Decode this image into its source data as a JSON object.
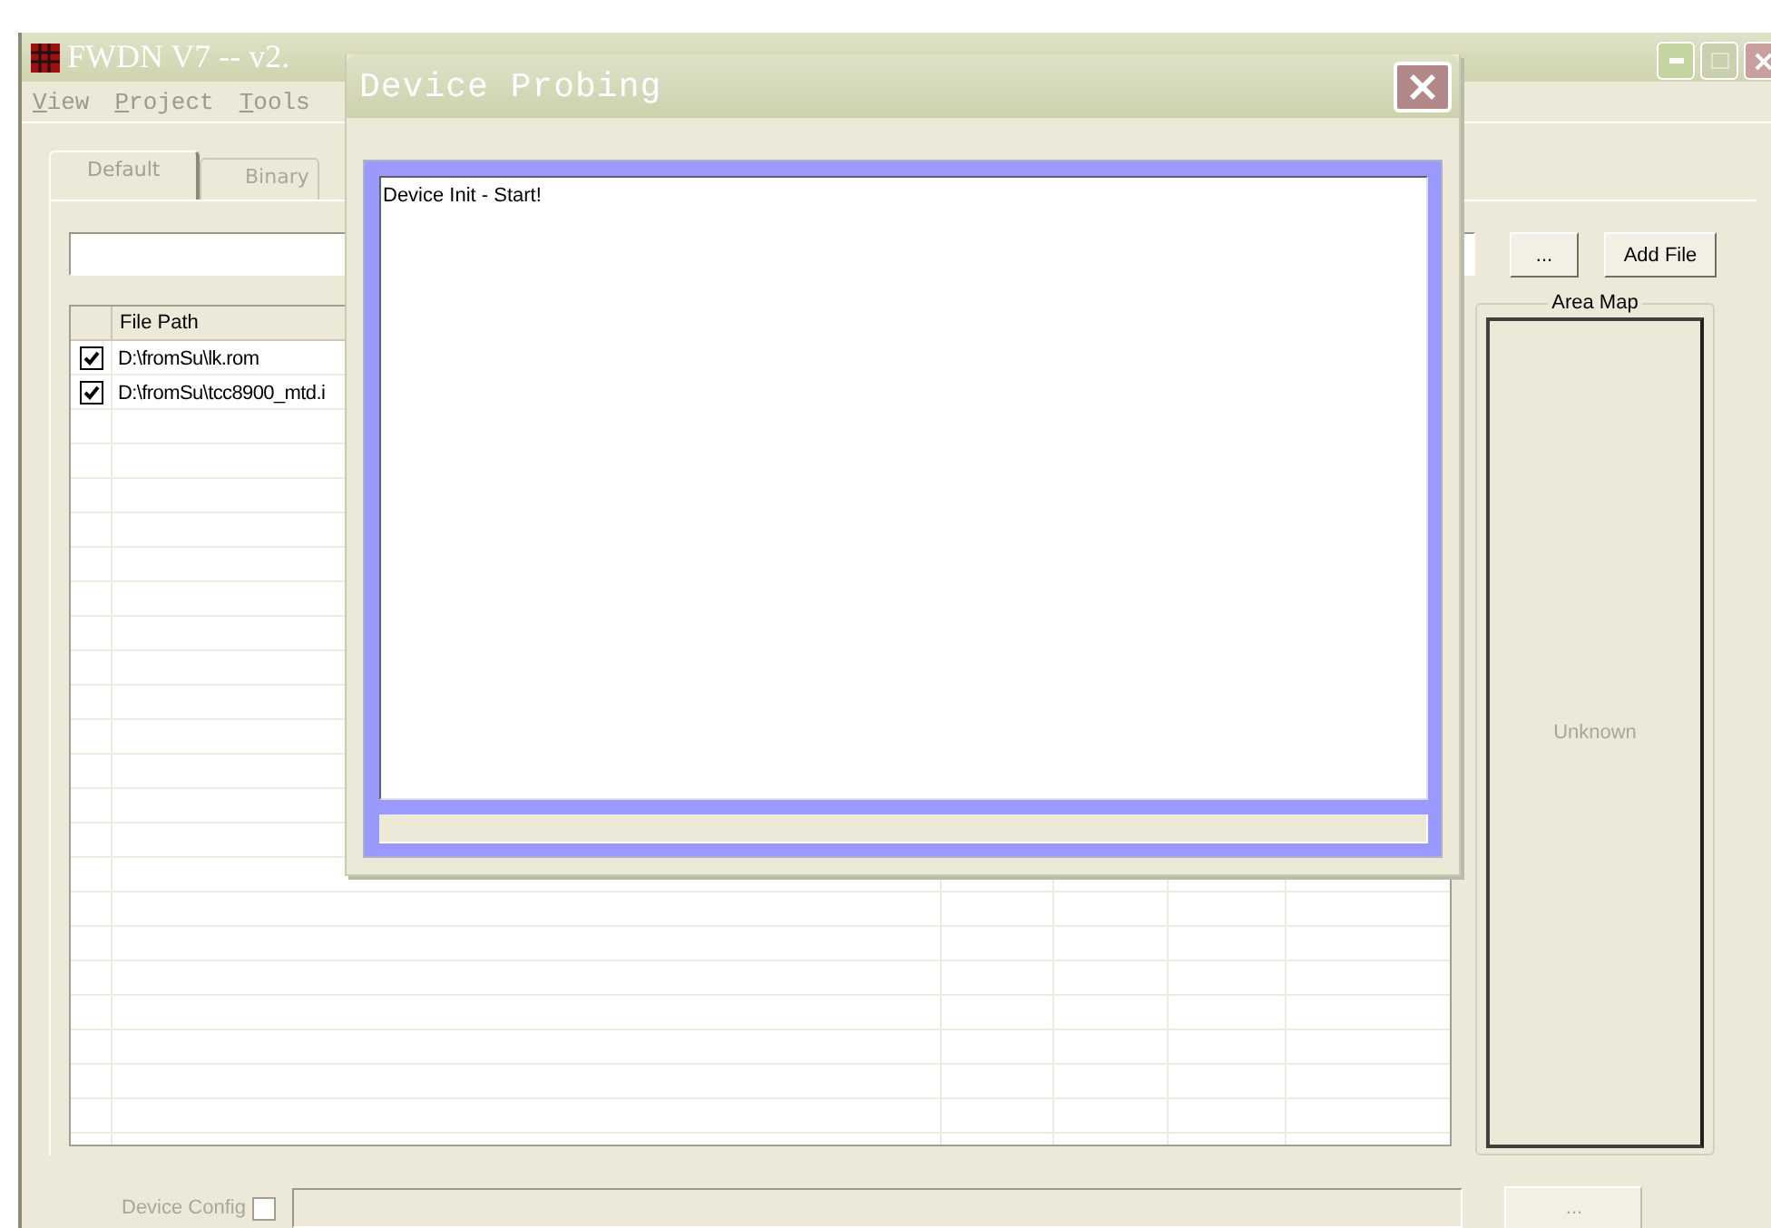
{
  "window": {
    "title": "FWDN V7 -- v2."
  },
  "menu": [
    {
      "label": "View"
    },
    {
      "label": "Project"
    },
    {
      "label": "Tools"
    }
  ],
  "tabs": [
    {
      "label": "Default",
      "selected": true
    },
    {
      "label": "Binary",
      "selected": false
    }
  ],
  "file_buttons": [
    {
      "label": "..."
    },
    {
      "label": "Add File"
    }
  ],
  "file_table": {
    "columns": [
      "File Path"
    ],
    "rows": [
      {
        "checked": true,
        "path": "D:\\fromSu\\lk.rom"
      },
      {
        "checked": true,
        "path": "D:\\fromSu\\tcc8900_mtd.i"
      }
    ]
  },
  "area_map": {
    "title": "Area Map",
    "label": "Unknown"
  },
  "device_config": {
    "label": "Device Config",
    "checked": false,
    "button": "...",
    "disabled": true
  },
  "dialog": {
    "title": "Device Probing",
    "log": "Device Init - Start!"
  }
}
